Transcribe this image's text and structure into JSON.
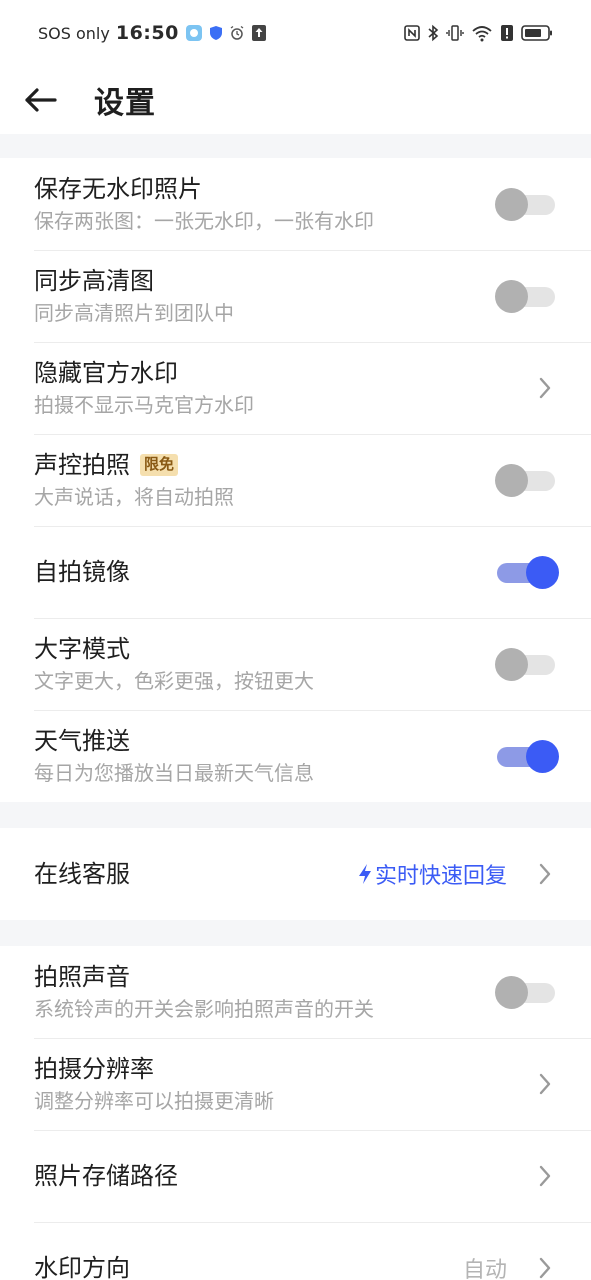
{
  "status_bar": {
    "carrier": "SOS only",
    "time": "16:50",
    "battery_label": "battery"
  },
  "header": {
    "back_icon": "arrow-left-icon",
    "title": "设置"
  },
  "settings": {
    "save_no_watermark": {
      "title": "保存无水印照片",
      "subtitle": "保存两张图：一张无水印，一张有水印",
      "enabled": false
    },
    "sync_hd": {
      "title": "同步高清图",
      "subtitle": "同步高清照片到团队中",
      "enabled": false
    },
    "hide_official_watermark": {
      "title": "隐藏官方水印",
      "subtitle": "拍摄不显示马克官方水印"
    },
    "voice_capture": {
      "title": "声控拍照",
      "badge": "限免",
      "subtitle": "大声说话，将自动拍照",
      "enabled": false
    },
    "selfie_mirror": {
      "title": "自拍镜像",
      "enabled": true
    },
    "large_text": {
      "title": "大字模式",
      "subtitle": "文字更大，色彩更强，按钮更大",
      "enabled": false
    },
    "weather_push": {
      "title": "天气推送",
      "subtitle": "每日为您播放当日最新天气信息",
      "enabled": true
    },
    "online_service": {
      "title": "在线客服",
      "value": "实时快速回复"
    },
    "shutter_sound": {
      "title": "拍照声音",
      "subtitle": "系统铃声的开关会影响拍照声音的开关",
      "enabled": false
    },
    "resolution": {
      "title": "拍摄分辨率",
      "subtitle": "调整分辨率可以拍摄更清晰"
    },
    "storage_path": {
      "title": "照片存储路径"
    },
    "watermark_direction": {
      "title": "水印方向",
      "value": "自动"
    }
  },
  "colors": {
    "accent": "#3b5bf5",
    "toggle_on_track": "#8d9ae6",
    "toggle_off_knob": "#b1b1b1",
    "section_gap": "#f5f6f8",
    "badge_bg": "#f5dfae"
  }
}
